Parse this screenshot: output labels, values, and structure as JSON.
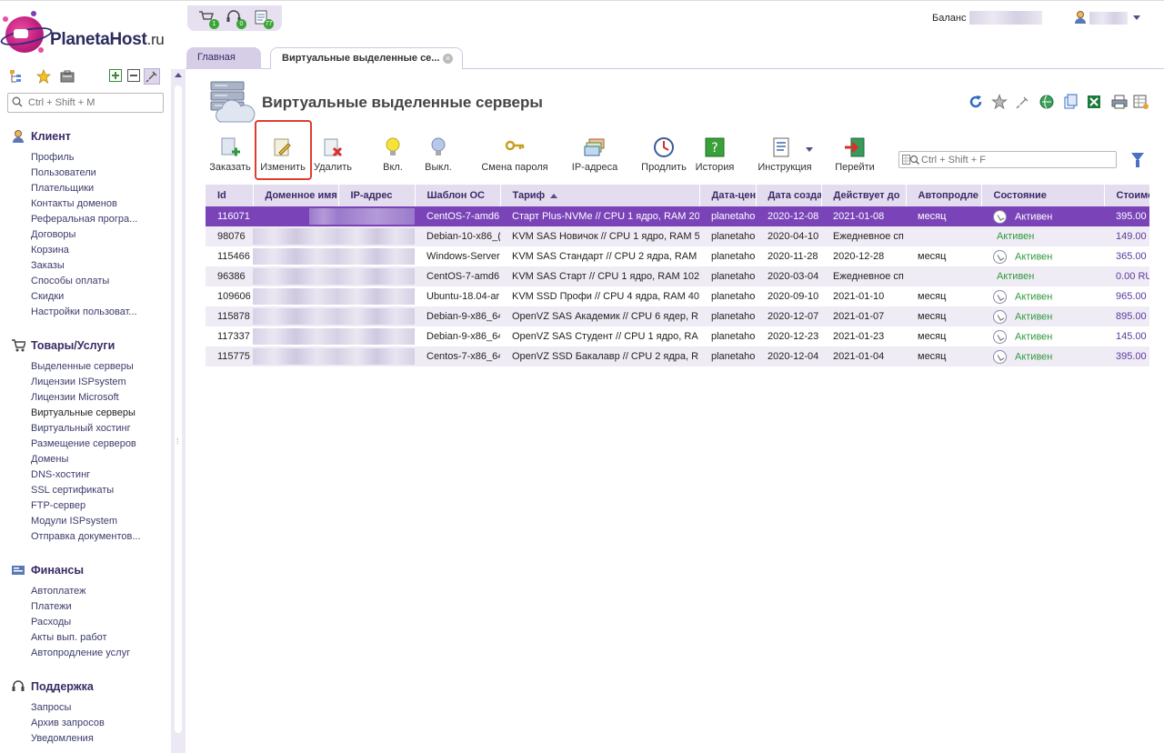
{
  "brand": {
    "name": "PlanetaHost",
    "tld": ".ru"
  },
  "sidebar": {
    "search_placeholder": "Ctrl + Shift + M",
    "groups": [
      {
        "title": "Клиент",
        "items": [
          "Профиль",
          "Пользователи",
          "Плательщики",
          "Контакты доменов",
          "Реферальная програ...",
          "Договоры",
          "Корзина",
          "Заказы",
          "Способы оплаты",
          "Скидки",
          "Настройки пользоват..."
        ]
      },
      {
        "title": "Товары/Услуги",
        "items": [
          "Выделенные серверы",
          "Лицензии ISPsystem",
          "Лицензии Microsoft",
          "Виртуальные серверы",
          "Виртуальный хостинг",
          "Размещение серверов",
          "Домены",
          "DNS-хостинг",
          "SSL сертификаты",
          "FTP-сервер",
          "Модули ISPsystem",
          "Отправка документов..."
        ]
      },
      {
        "title": "Финансы",
        "items": [
          "Автоплатеж",
          "Платежи",
          "Расходы",
          "Акты вып. работ",
          "Автопродление услуг"
        ]
      },
      {
        "title": "Поддержка",
        "items": [
          "Запросы",
          "Архив запросов",
          "Уведомления"
        ]
      }
    ]
  },
  "topbar": {
    "badges": [
      "1",
      "0",
      "77"
    ],
    "balance_label": "Баланс"
  },
  "tabs": {
    "home": "Главная",
    "current": "Виртуальные выделенные се..."
  },
  "page": {
    "title": "Виртуальные выделенные серверы"
  },
  "toolbar": {
    "buttons": [
      "Заказать",
      "Изменить",
      "Удалить",
      "Вкл.",
      "Выкл.",
      "Смена пароля",
      "IP-адреса",
      "Продлить",
      "История",
      "Инструкция",
      "Перейти"
    ],
    "search_placeholder": "Ctrl + Shift + F"
  },
  "table": {
    "columns": [
      "Id",
      "Доменное имя",
      "IP-адрес",
      "Шаблон ОС",
      "Тариф",
      "Дата-цен",
      "Дата созда",
      "Действует до",
      "Автопродле",
      "Состояние",
      "Стоимо"
    ],
    "rows": [
      [
        "116071",
        "",
        "",
        "CentOS-7-amd6",
        "Старт Plus-NVMe // CPU 1 ядро, RAM 20",
        "planetaho",
        "2020-12-08",
        "2021-01-08",
        "месяц",
        "Активен",
        "395.00"
      ],
      [
        "98076",
        "",
        "",
        "Debian-10-x86_(",
        "KVM SAS Новичок // CPU 1 ядро, RAM 5",
        "planetaho",
        "2020-04-10",
        "Ежедневное сп",
        "",
        "Активен",
        "149.00"
      ],
      [
        "115466",
        "",
        "",
        "Windows-Server",
        "KVM SAS Стандарт // CPU 2 ядра, RAM",
        "planetaho",
        "2020-11-28",
        "2020-12-28",
        "месяц",
        "Активен",
        "365.00"
      ],
      [
        "96386",
        "",
        "",
        "CentOS-7-amd6",
        "KVM SAS Старт // CPU 1 ядро, RAM 102",
        "planetaho",
        "2020-03-04",
        "Ежедневное сп",
        "",
        "Активен",
        "0.00 RU"
      ],
      [
        "109606",
        "",
        "",
        "Ubuntu-18.04-ar",
        "KVM SSD Профи // CPU 4 ядра, RAM 40",
        "planetaho",
        "2020-09-10",
        "2021-01-10",
        "месяц",
        "Активен",
        "965.00"
      ],
      [
        "115878",
        "",
        "",
        "Debian-9-x86_64",
        "OpenVZ SAS Академик // CPU 6 ядер, R",
        "planetaho",
        "2020-12-07",
        "2021-01-07",
        "месяц",
        "Активен",
        "895.00"
      ],
      [
        "117337",
        "",
        "",
        "Debian-9-x86_64",
        "OpenVZ SAS Студент // CPU 1 ядро, RA",
        "planetaho",
        "2020-12-23",
        "2021-01-23",
        "месяц",
        "Активен",
        "145.00"
      ],
      [
        "115775",
        "",
        "",
        "Centos-7-x86_64",
        "OpenVZ SSD Бакалавр // CPU 2 ядра, R",
        "planetaho",
        "2020-12-04",
        "2021-01-04",
        "месяц",
        "Активен",
        "395.00"
      ]
    ],
    "status_icon": [
      true,
      false,
      true,
      false,
      true,
      true,
      true,
      true
    ],
    "selected_row": 0
  },
  "colors": {
    "accent": "#7a44b8",
    "header_bg": "#e3ddef",
    "highlight": "#e03c31",
    "active_green": "#2e9a3a"
  }
}
